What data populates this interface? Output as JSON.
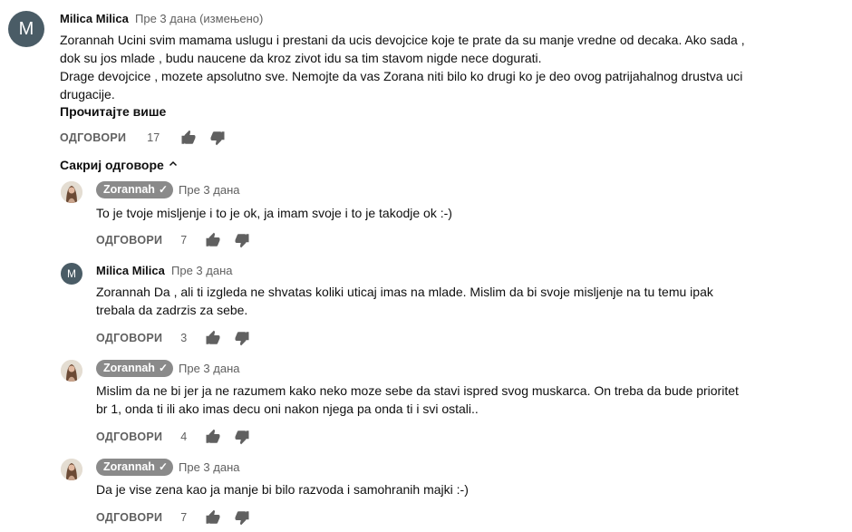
{
  "comment": {
    "avatar_letter": "M",
    "author": "Milica Milica",
    "time": "Пре 3 дана (измењено)",
    "lines": [
      "Zorannah Ucini svim mamama uslugu i prestani da ucis devojcice koje te prate da su manje vredne od decaka. Ako sada ,",
      "dok su jos mlade , budu naucene da kroz zivot idu sa tim stavom nigde nece dogurati.",
      "Drage devojcice , mozete apsolutno sve. Nemojte da vas Zorana niti bilo ko drugi ko je deo ovog patrijahalnog drustva uci",
      "drugacije."
    ],
    "read_more": "Прочитајте више",
    "reply_label": "ОДГОВОРИ",
    "likes": "17"
  },
  "hide_replies": {
    "label": "Сакриј одговоре",
    "icon": "chevron-up-icon"
  },
  "replies": [
    {
      "author": "Zorannah",
      "verified": true,
      "time": "Пре 3 дана",
      "lines": [
        "To je tvoje misljenje i to je ok, ja imam svoje i to je takodje ok :-)"
      ],
      "reply_label": "ОДГОВОРИ",
      "likes": "7"
    },
    {
      "author": "Milica Milica",
      "avatar_letter": "M",
      "verified": false,
      "time": "Пре 3 дана",
      "lines": [
        "Zorannah Da , ali ti izgleda ne shvatas koliki uticaj imas na mlade. Mislim da bi svoje misljenje na tu temu ipak",
        "trebala da zadrzis za sebe."
      ],
      "reply_label": "ОДГОВОРИ",
      "likes": "3"
    },
    {
      "author": "Zorannah",
      "verified": true,
      "time": "Пре 3 дана",
      "lines": [
        "Mislim da ne bi jer ja ne razumem kako neko moze sebe da stavi ispred svog muskarca. On treba da bude prioritet",
        "br 1, onda ti ili ako imas decu oni nakon njega pa onda ti i svi ostali.."
      ],
      "reply_label": "ОДГОВОРИ",
      "likes": "4"
    },
    {
      "author": "Zorannah",
      "verified": true,
      "time": "Пре 3 дана",
      "lines": [
        "Da je vise zena kao ja manje bi bilo razvoda i samohranih majki :-)"
      ],
      "reply_label": "ОДГОВОРИ",
      "likes": "7"
    }
  ],
  "colors": {
    "text": "#0f0f0f",
    "secondary": "#606060",
    "chip_bg": "#8a8a8a",
    "avatar_bg": "#4a5c66"
  }
}
